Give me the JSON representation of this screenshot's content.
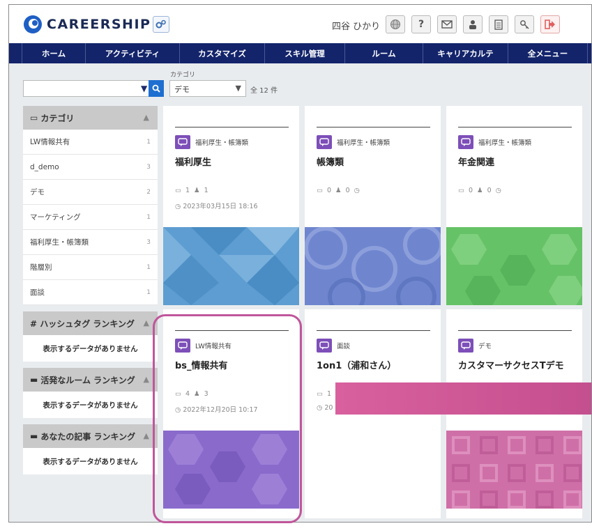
{
  "header": {
    "logo_text": "CAREERSHIP",
    "user_name": "四谷 ひかり",
    "tool_icons": [
      "globe-icon",
      "help-icon",
      "mail-icon",
      "profile-icon",
      "document-icon",
      "key-icon",
      "logout-icon"
    ],
    "help_label": "?"
  },
  "nav": [
    {
      "label": "ホーム"
    },
    {
      "label": "アクティビティ"
    },
    {
      "label": "カスタマイズ"
    },
    {
      "label": "スキル管理"
    },
    {
      "label": "ルーム"
    },
    {
      "label": "キャリアカルテ"
    },
    {
      "label": "全メニュー"
    }
  ],
  "filters": {
    "search_value": "",
    "category_label": "カテゴリ",
    "category_value": "デモ",
    "count": "全 12 件"
  },
  "sidebar": {
    "category_title": "カテゴリ",
    "categories": [
      {
        "name": "LW情報共有",
        "count": "1"
      },
      {
        "name": "d_demo",
        "count": "3"
      },
      {
        "name": "デモ",
        "count": "2"
      },
      {
        "name": "マーケティング",
        "count": "1"
      },
      {
        "name": "福利厚生・帳簿類",
        "count": "3"
      },
      {
        "name": "階層別",
        "count": "1"
      },
      {
        "name": "面談",
        "count": "1"
      }
    ],
    "hashtag_title": "# ハッシュタグ ランキング",
    "hashtag_empty": "表示するデータがありません",
    "active_room_title": "活発なルーム ランキング",
    "active_room_empty": "表示するデータがありません",
    "my_posts_title": "あなたの記事 ランキング",
    "my_posts_empty": "表示するデータがありません"
  },
  "cards": [
    {
      "category": "福利厚生・帳簿類",
      "title": "福利厚生",
      "posts": "1",
      "members": "1",
      "date": "2023年03月15日 18:16",
      "color": "#5b9bd2"
    },
    {
      "category": "福利厚生・帳簿類",
      "title": "帳簿類",
      "posts": "0",
      "members": "0",
      "date": "",
      "color": "#6f86cf"
    },
    {
      "category": "福利厚生・帳簿類",
      "title": "年金関連",
      "posts": "0",
      "members": "0",
      "date": "",
      "color": "#66c267"
    },
    {
      "category": "LW情報共有",
      "title": "bs_情報共有",
      "posts": "4",
      "members": "3",
      "date": "2022年12月20日 10:17",
      "color": "#8a6bcc"
    },
    {
      "category": "面談",
      "title": "1on1（浦和さん）",
      "posts": "1",
      "members": "",
      "date": "20",
      "color": ""
    },
    {
      "category": "デモ",
      "title": "カスタマーサクセスTデモ",
      "posts": "",
      "members": "",
      "date": "",
      "color": "#cf6fa8"
    }
  ]
}
